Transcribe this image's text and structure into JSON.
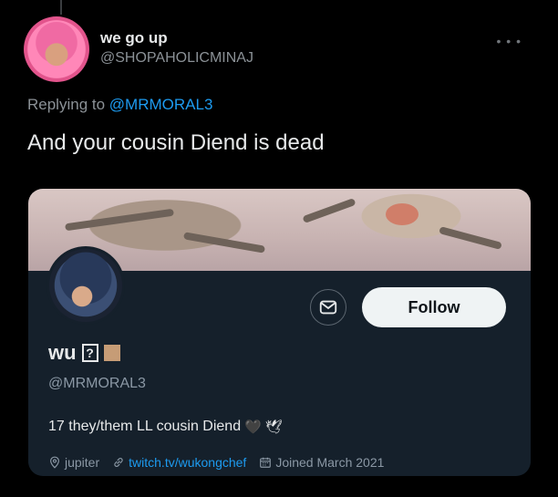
{
  "tweet": {
    "display_name": "we go up",
    "handle": "@SHOPAHOLICMINAJ",
    "replying_prefix": "Replying to",
    "replying_to": "@MRMORAL3",
    "text": "And your cousin Diend is dead",
    "more_icon": "more-dots-icon"
  },
  "profile_card": {
    "display_name": "wu",
    "missing_glyph": "?",
    "handle": "@MRMORAL3",
    "follow_label": "Follow",
    "bio": "17 they/them LL cousin Diend",
    "bio_emoji_1": "🖤",
    "bio_emoji_2": "🕊",
    "location": "jupiter",
    "link": "twitch.tv/wukongchef",
    "joined": "Joined March 2021"
  },
  "colors": {
    "background": "#000000",
    "card": "#15202b",
    "link": "#1d9bf0",
    "secondary_text": "#8b9196",
    "follow_bg": "#eff3f4",
    "skin_tone_square": "#c69c76"
  }
}
